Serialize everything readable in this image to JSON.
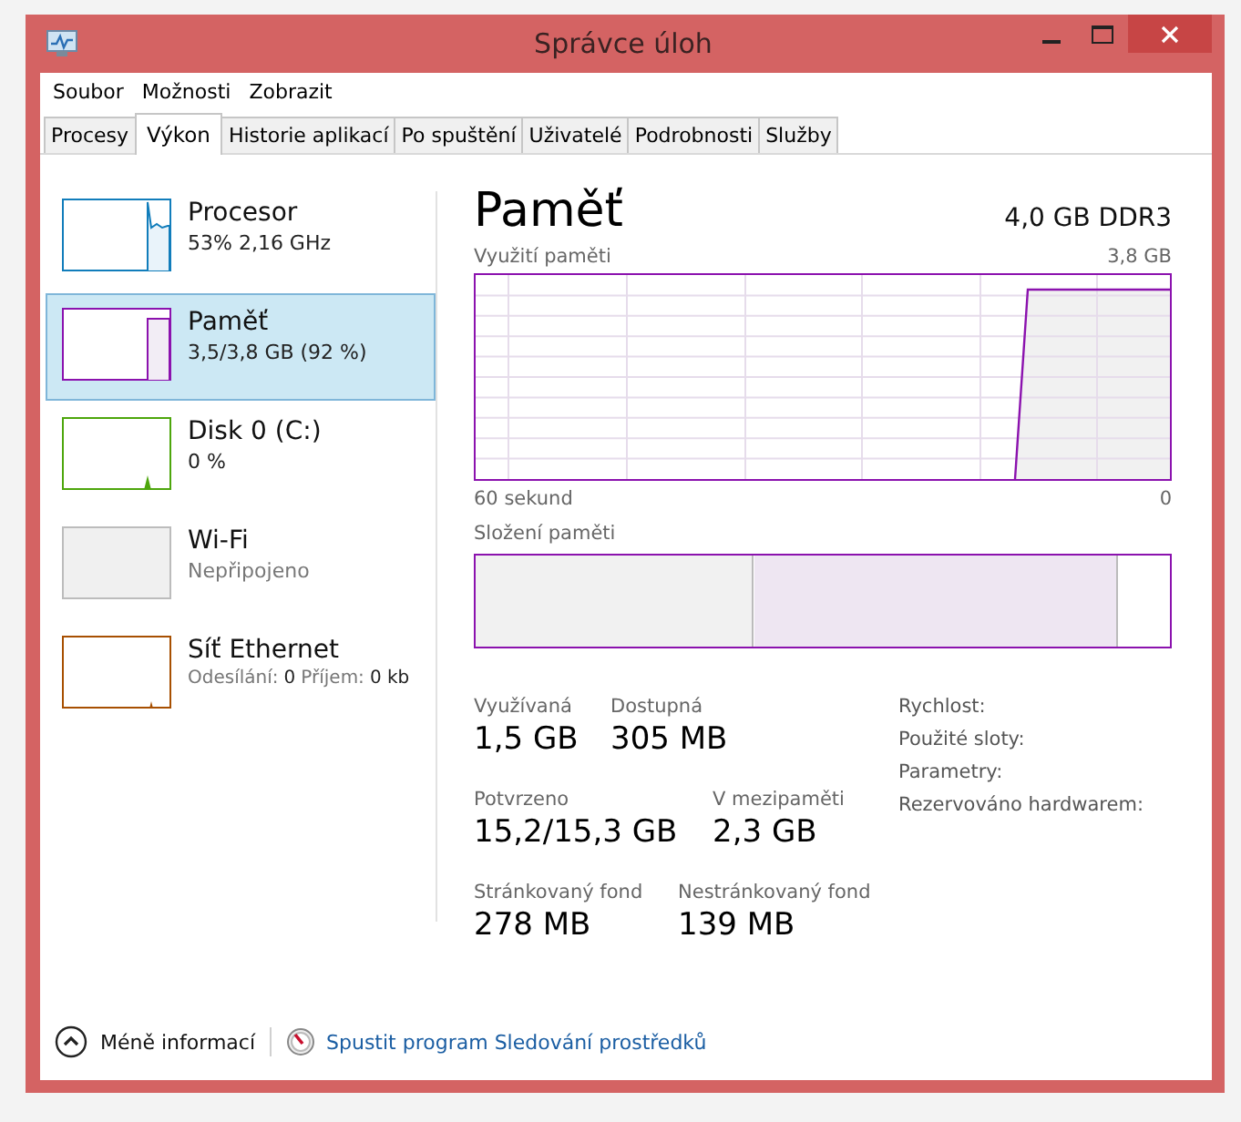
{
  "window": {
    "title": "Správce úloh"
  },
  "menu": [
    "Soubor",
    "Možnosti",
    "Zobrazit"
  ],
  "tabs": [
    {
      "label": "Procesy",
      "selected": false
    },
    {
      "label": "Výkon",
      "selected": true
    },
    {
      "label": "Historie aplikací",
      "selected": false
    },
    {
      "label": "Po spuštění",
      "selected": false
    },
    {
      "label": "Uživatelé",
      "selected": false
    },
    {
      "label": "Podrobnosti",
      "selected": false
    },
    {
      "label": "Služby",
      "selected": false
    }
  ],
  "sidebar": {
    "items": [
      {
        "kind": "cpu",
        "name": "Procesor",
        "detail": "53% 2,16 GHz",
        "color": "#117dbb",
        "selected": false
      },
      {
        "kind": "memory",
        "name": "Paměť",
        "detail": "3,5/3,8 GB (92 %)",
        "color": "#8b12ae",
        "selected": true
      },
      {
        "kind": "disk",
        "name": "Disk 0 (C:)",
        "detail": "0 %",
        "color": "#4da60c",
        "selected": false
      },
      {
        "kind": "wifi",
        "name": "Wi-Fi",
        "detail": "Nepřipojeno",
        "color": "#bcbcbc",
        "selected": false
      },
      {
        "kind": "ethernet",
        "name": "Síť Ethernet",
        "detail_parts": [
          {
            "label": "Odesílání:",
            "value": "0"
          },
          {
            "label": "Příjem:",
            "value": "0 kb"
          }
        ],
        "color": "#a74f01",
        "selected": false
      }
    ]
  },
  "panel": {
    "title": "Paměť",
    "hardware": "4,0 GB DDR3",
    "usage_label": "Využití paměti",
    "usage_max": "3,8 GB",
    "time_start": "60 sekund",
    "time_end": "0",
    "composition_label": "Složení paměti",
    "stats": [
      [
        {
          "label": "Využívaná",
          "value": "1,5 GB"
        },
        {
          "label": "Dostupná",
          "value": "305 MB"
        }
      ],
      [
        {
          "label": "Potvrzeno",
          "value": "15,2/15,3 GB"
        },
        {
          "label": "V mezipaměti",
          "value": "2,3 GB"
        }
      ],
      [
        {
          "label": "Stránkovaný fond",
          "value": "278 MB"
        },
        {
          "label": "Nestránkovaný fond",
          "value": "139 MB"
        }
      ]
    ],
    "properties": [
      "Rychlost:",
      "Použité sloty:",
      "Parametry:",
      "Rezervováno hardwarem:"
    ]
  },
  "footer": {
    "less_details": "Méně informací",
    "monitor_link": "Spustit program Sledování prostředků"
  }
}
